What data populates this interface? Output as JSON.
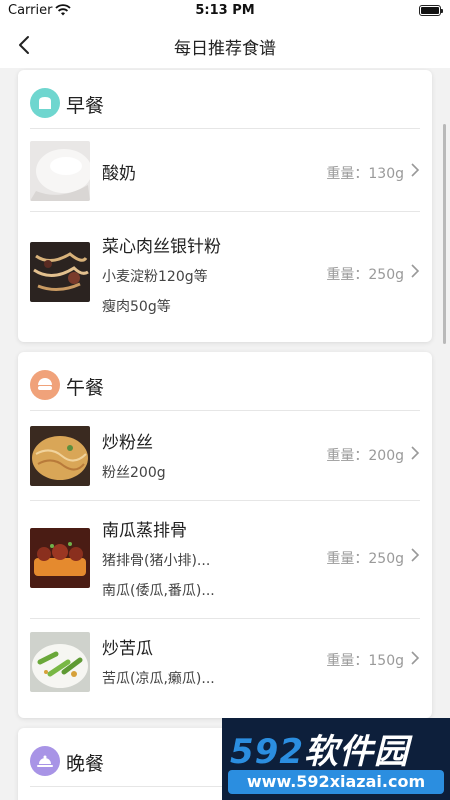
{
  "status_bar": {
    "carrier": "Carrier",
    "time": "5:13 PM"
  },
  "nav": {
    "title": "每日推荐食谱"
  },
  "meals": {
    "breakfast": {
      "title": "早餐",
      "icon_color": "#6fd6cf",
      "items": [
        {
          "name": "酸奶",
          "weight": "重量：130g",
          "sub": []
        },
        {
          "name": "菜心肉丝银针粉",
          "weight": "重量：250g",
          "sub": [
            "小麦淀粉120g等",
            "瘦肉50g等"
          ]
        }
      ]
    },
    "lunch": {
      "title": "午餐",
      "icon_color": "#f0a27a",
      "items": [
        {
          "name": "炒粉丝",
          "weight": "重量：200g",
          "sub": [
            "粉丝200g"
          ]
        },
        {
          "name": "南瓜蒸排骨",
          "weight": "重量：250g",
          "sub": [
            "猪排骨(猪小排)...",
            "南瓜(倭瓜,番瓜)..."
          ]
        },
        {
          "name": "炒苦瓜",
          "weight": "重量：150g",
          "sub": [
            "苦瓜(凉瓜,癞瓜)..."
          ]
        }
      ]
    },
    "dinner": {
      "title": "晚餐",
      "icon_color": "#a894e6"
    }
  },
  "watermark": {
    "brand_num": "592",
    "brand_text": "软件园",
    "url": "www.592xiazai.com"
  }
}
